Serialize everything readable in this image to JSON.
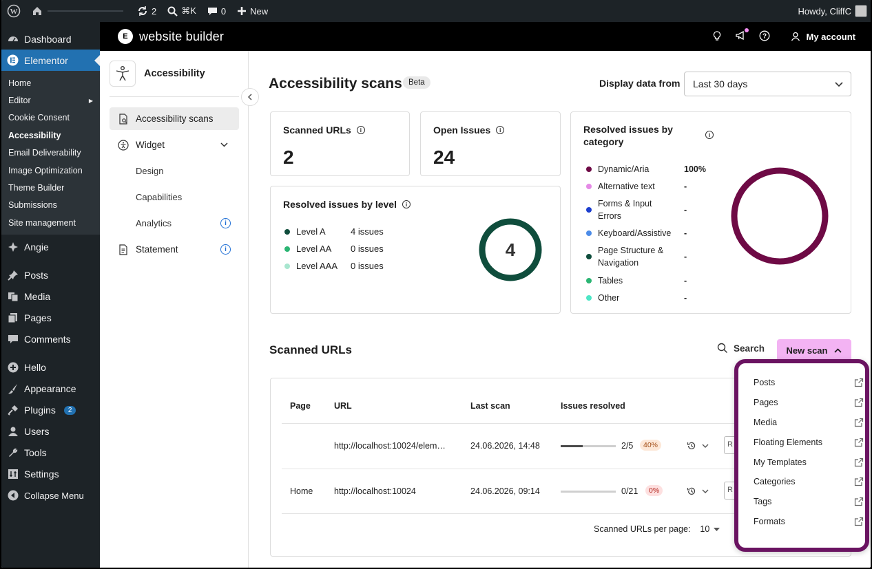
{
  "adminbar": {
    "updates_count": "2",
    "search_shortcut": "⌘K",
    "comments_count": "0",
    "new_label": "New",
    "howdy": "Howdy, CliffC"
  },
  "sidebar": {
    "dashboard": "Dashboard",
    "elementor": "Elementor",
    "sub": [
      "Home",
      "Editor",
      "Cookie Consent",
      "Accessibility",
      "Email Deliverability",
      "Image Optimization",
      "Theme Builder",
      "Submissions",
      "Site management"
    ],
    "items": [
      "Angie",
      "Posts",
      "Media",
      "Pages",
      "Comments",
      "Hello",
      "Appearance",
      "Plugins",
      "Users",
      "Tools",
      "Settings",
      "Collapse Menu"
    ],
    "plugins_badge": "2"
  },
  "topbar": {
    "brand": "website builder",
    "my_account": "My account"
  },
  "panel": {
    "title": "Accessibility",
    "nav_scans": "Accessibility scans",
    "nav_widget": "Widget",
    "nav_design": "Design",
    "nav_capabilities": "Capabilities",
    "nav_analytics": "Analytics",
    "nav_statement": "Statement"
  },
  "main": {
    "title": "Accessibility scans",
    "beta": "Beta",
    "display_from_label": "Display data from",
    "display_from_value": "Last 30 days",
    "scanned_urls_label": "Scanned URLs",
    "scanned_urls_value": "2",
    "open_issues_label": "Open Issues",
    "open_issues_value": "24",
    "by_level_title": "Resolved issues by level",
    "levels": [
      {
        "name": "Level A",
        "value": "4 issues",
        "color": "#0f4d3c"
      },
      {
        "name": "Level AA",
        "value": "0 issues",
        "color": "#2bb573"
      },
      {
        "name": "Level AAA",
        "value": "0 issues",
        "color": "#a8e6cf"
      }
    ],
    "level_total": "4",
    "by_category_title": "Resolved issues by category",
    "categories": [
      {
        "name": "Dynamic/Aria",
        "value": "100%",
        "color": "#6e0a45"
      },
      {
        "name": "Alternative text",
        "value": "-",
        "color": "#e58ae6"
      },
      {
        "name": "Forms & Input Errors",
        "value": "-",
        "color": "#1d3fcf"
      },
      {
        "name": "Keyboard/Assistive",
        "value": "-",
        "color": "#4c8ce8"
      },
      {
        "name": "Page Structure & Navigation",
        "value": "-",
        "color": "#0f4d3c"
      },
      {
        "name": "Tables",
        "value": "-",
        "color": "#2bb573"
      },
      {
        "name": "Other",
        "value": "-",
        "color": "#4ee6c6"
      }
    ],
    "scanned_section_title": "Scanned URLs",
    "search_label": "Search",
    "new_scan_label": "New scan"
  },
  "table": {
    "headers": [
      "Page",
      "URL",
      "Last scan",
      "Issues resolved"
    ],
    "rows": [
      {
        "page": "",
        "url": "http://localhost:10024/elem…",
        "last_scan": "24.06.2026, 14:48",
        "resolved": "2/5",
        "resolved_fraction": 0.4,
        "pct": "40%"
      },
      {
        "page": "Home",
        "url": "http://localhost:10024",
        "last_scan": "24.06.2026, 09:14",
        "resolved": "0/21",
        "resolved_fraction": 0,
        "pct": "0%"
      }
    ],
    "per_page_label": "Scanned URLs per page:",
    "per_page_value": "10"
  },
  "dropdown": {
    "items": [
      "Posts",
      "Pages",
      "Media",
      "Floating Elements",
      "My Templates",
      "Categories",
      "Tags",
      "Formats"
    ]
  }
}
